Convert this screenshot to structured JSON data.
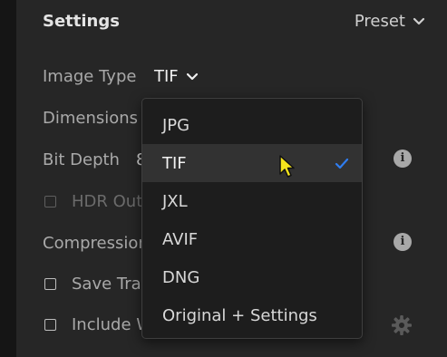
{
  "header": {
    "title": "Settings",
    "preset_label": "Preset"
  },
  "rows": {
    "image_type_label": "Image Type",
    "image_type_value": "TIF",
    "dimensions_label": "Dimensions",
    "bit_depth_label": "Bit Depth",
    "bit_depth_value_partial": "8",
    "hdr_label": "HDR Out",
    "hdr_checked": false,
    "hdr_enabled": false,
    "compression_label": "Compression",
    "save_transparency_label": "Save Tran",
    "save_transparency_checked": false,
    "include_label": "Include W",
    "include_checked": false
  },
  "dropdown": {
    "options": [
      "JPG",
      "TIF",
      "JXL",
      "AVIF",
      "DNG",
      "Original + Settings"
    ],
    "selected": "TIF"
  },
  "colors": {
    "panel_bg": "#262626",
    "dropdown_bg": "#1d1d1d",
    "selected_row_bg": "#323232",
    "checkmark_blue": "#2f7df0",
    "cursor_yellow": "#f7e51c"
  },
  "icons": [
    "chevron-down-icon",
    "info-icon",
    "gear-icon",
    "checkmark-icon",
    "mouse-cursor-icon"
  ]
}
